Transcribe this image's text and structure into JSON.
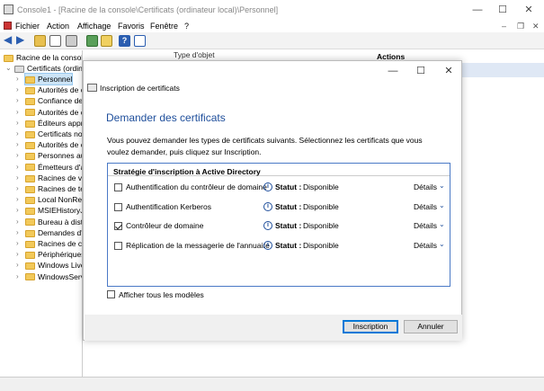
{
  "window": {
    "title": "Console1 - [Racine de la console\\Certificats (ordinateur local)\\Personnel]",
    "minimize": "—",
    "maximize": "☐",
    "close": "✕"
  },
  "menu": [
    "Fichier",
    "Action",
    "Affichage",
    "Favoris",
    "Fenêtre",
    "?"
  ],
  "tree": {
    "root": "Racine de la console",
    "certs": "Certificats (ordina",
    "items": [
      "Personnel",
      "Autorités de c",
      "Confiance de",
      "Autorités de c",
      "Éditeurs appr",
      "Certificats no",
      "Autorités de c",
      "Personnes au",
      "Émetteurs d'a",
      "Racines de ve",
      "Racines de tes",
      "Local NonRer",
      "MSIEHistoryJc",
      "Bureau à dista",
      "Demandes d'i",
      "Racines de co",
      "Périphériques",
      "Windows Live",
      "WindowsServ"
    ]
  },
  "middle_header": "Type d'objet",
  "actions_header": "Actions",
  "dialog": {
    "title": "Inscription de certificats",
    "heading": "Demander des certificats",
    "description": "Vous pouvez demander les types de certificats suivants. Sélectionnez les certificats que vous voulez demander, puis cliquez sur Inscription.",
    "list_header": "Stratégie d'inscription à Active Directory",
    "status_label": "Statut :",
    "details_label": "Détails",
    "rows": [
      {
        "label": "Authentification du contrôleur de domaine",
        "status": "Disponible",
        "checked": false
      },
      {
        "label": "Authentification Kerberos",
        "status": "Disponible",
        "checked": false
      },
      {
        "label": "Contrôleur de domaine",
        "status": "Disponible",
        "checked": true
      },
      {
        "label": "Réplication de la messagerie de l'annuaire",
        "status": "Disponible",
        "checked": false
      }
    ],
    "show_all": "Afficher tous les modèles",
    "enroll_button": "Inscription",
    "cancel_button": "Annuler"
  }
}
